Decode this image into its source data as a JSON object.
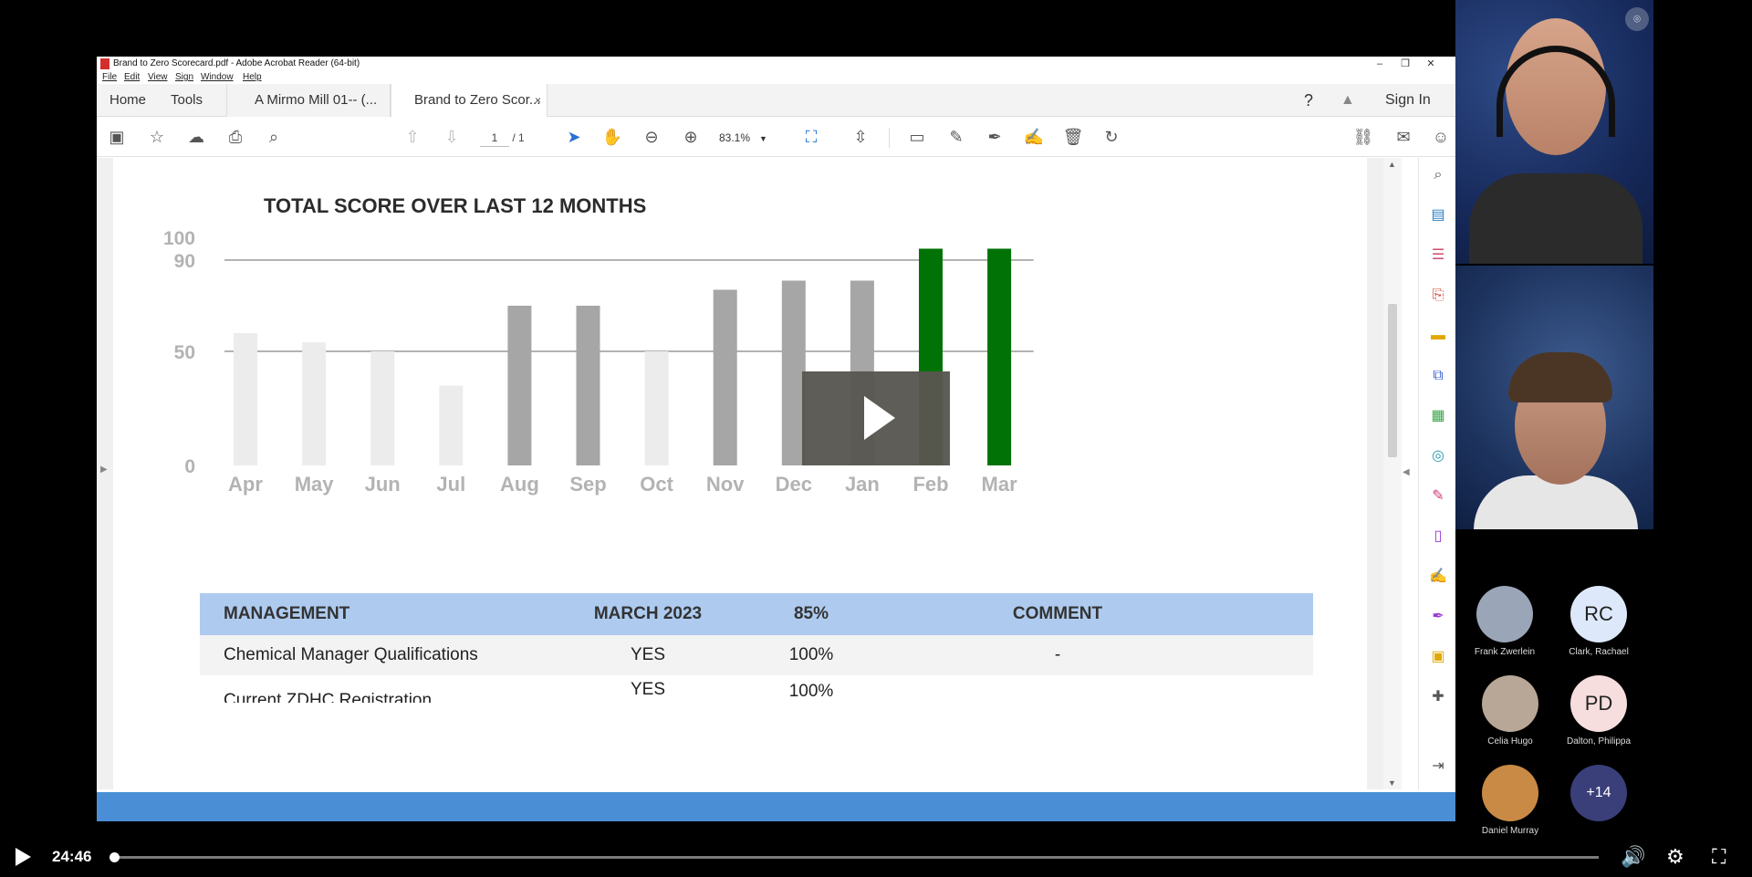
{
  "window": {
    "title": "Brand to Zero Scorecard.pdf - Adobe Acrobat Reader (64-bit)",
    "controls": {
      "minimize": "–",
      "restore": "❐",
      "close": "✕"
    }
  },
  "menu": [
    "File",
    "Edit",
    "View",
    "Sign",
    "Window",
    "Help"
  ],
  "tabs": {
    "home": "Home",
    "tools": "Tools",
    "doc1": "A Mirmo Mill 01-- (...",
    "doc2": "Brand to Zero Scor...",
    "close": "×",
    "signin": "Sign In"
  },
  "toolbar": {
    "page_current": "1",
    "page_total": "/ 1",
    "zoom": "83.1%"
  },
  "chart_data": {
    "type": "bar",
    "title": "TOTAL SCORE OVER LAST 12 MONTHS",
    "categories": [
      "Apr",
      "May",
      "Jun",
      "Jul",
      "Aug",
      "Sep",
      "Oct",
      "Nov",
      "Dec",
      "Jan",
      "Feb",
      "Mar"
    ],
    "values": [
      58,
      54,
      50,
      35,
      70,
      70,
      50,
      77,
      81,
      81,
      95,
      95
    ],
    "bar_colors": [
      "#ececec",
      "#ececec",
      "#ececec",
      "#ececec",
      "#a6a6a6",
      "#a6a6a6",
      "#ececec",
      "#a6a6a6",
      "#a6a6a6",
      "#a6a6a6",
      "#007206",
      "#007206"
    ],
    "yticks": [
      "0",
      "50",
      "90",
      "100"
    ],
    "reference_lines": [
      50,
      90
    ],
    "ylim": [
      0,
      100
    ],
    "xlabel": "",
    "ylabel": ""
  },
  "table": {
    "headers": [
      "MANAGEMENT",
      "MARCH 2023",
      "85%",
      "COMMENT"
    ],
    "rows": [
      [
        "Chemical Manager Qualifications",
        "YES",
        "100%",
        "-"
      ],
      [
        "Current ZDHC Registration",
        "YES",
        "100%",
        ""
      ]
    ]
  },
  "participants": [
    {
      "name": "Frank Zwerlein",
      "initials": "",
      "kind": "photo",
      "color": "#9aa6b8"
    },
    {
      "name": "Clark, Rachael",
      "initials": "RC",
      "kind": "initials",
      "color": "#dde9fa"
    },
    {
      "name": "Celia Hugo",
      "initials": "",
      "kind": "photo",
      "color": "#b8a796"
    },
    {
      "name": "Dalton, Philippa",
      "initials": "PD",
      "kind": "initials",
      "color": "#f7dede"
    },
    {
      "name": "Daniel Murray",
      "initials": "",
      "kind": "photo",
      "color": "#c98a45"
    },
    {
      "name": "",
      "initials": "+14",
      "kind": "more",
      "color": "#3a3f7a"
    }
  ],
  "player": {
    "time": "24:46",
    "progress": 0.002
  }
}
